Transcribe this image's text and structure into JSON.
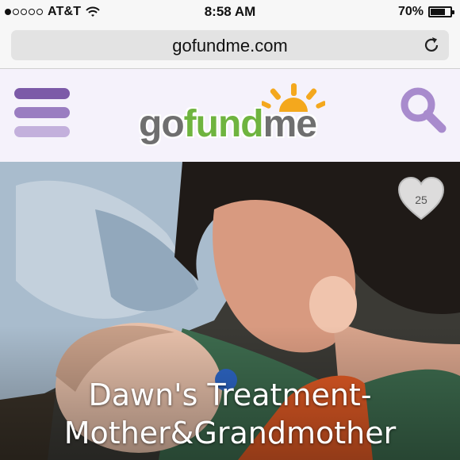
{
  "status_bar": {
    "carrier": "AT&T",
    "time": "8:58 AM",
    "battery_percent": "70%",
    "battery_level": 0.7,
    "signal_bars_filled": 1,
    "signal_bars_total": 5
  },
  "browser": {
    "url": "gofundme.com",
    "reload_icon": "reload-icon"
  },
  "site_header": {
    "logo": {
      "part_go": "go",
      "part_fund": "fund",
      "part_me": "me"
    },
    "menu_icon": "hamburger-menu-icon",
    "search_icon": "search-icon",
    "colors": {
      "brand_purple": "#7c5aa8",
      "brand_green": "#6fb43f",
      "sun_orange": "#f4a81d"
    }
  },
  "campaign": {
    "title_line1": "Dawn's Treatment-",
    "title_line2": "Mother&Grandmother",
    "hearts": "25"
  }
}
